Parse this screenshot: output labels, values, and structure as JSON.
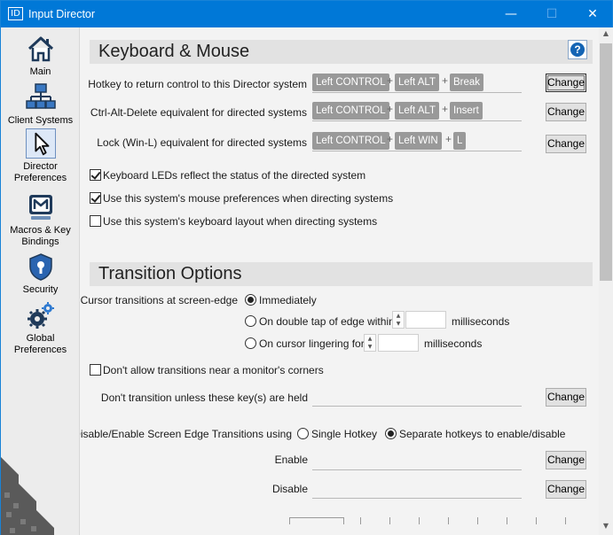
{
  "window": {
    "icon_text": "ID",
    "title": "Input Director",
    "minimize_glyph": "—",
    "maximize_glyph": "☐",
    "close_glyph": "✕"
  },
  "sidebar": {
    "items": [
      {
        "label": "Main",
        "icon": "home-icon"
      },
      {
        "label": "Client Systems",
        "icon": "network-icon"
      },
      {
        "label": "Director Preferences",
        "icon": "cursor-icon",
        "active": true
      },
      {
        "label": "Macros & Key Bindings",
        "icon": "macro-icon"
      },
      {
        "label": "Security",
        "icon": "shield-lock-icon"
      },
      {
        "label": "Global Preferences",
        "icon": "gears-icon"
      }
    ],
    "watermark_text": "AppNee Freeware Group."
  },
  "keyboard_mouse": {
    "title": "Keyboard & Mouse",
    "help_glyph": "?",
    "hotkeys": [
      {
        "label": "Hotkey to return control to this Director system",
        "keys": [
          "Left CONTROL",
          "Left ALT",
          "Break"
        ],
        "button": "Change"
      },
      {
        "label": "Ctrl-Alt-Delete equivalent for directed systems",
        "keys": [
          "Left CONTROL",
          "Left ALT",
          "Insert"
        ],
        "button": "Change"
      },
      {
        "label": "Lock (Win-L) equivalent for directed systems",
        "keys": [
          "Left CONTROL",
          "Left WIN",
          "L"
        ],
        "button": "Change"
      }
    ],
    "plus": "+",
    "checkboxes": [
      {
        "label": "Keyboard LEDs reflect the status of the directed system",
        "checked": true
      },
      {
        "label": "Use this system's mouse preferences when directing systems",
        "checked": true
      },
      {
        "label": "Use this system's keyboard layout when directing systems",
        "checked": false
      }
    ]
  },
  "transition": {
    "title": "Transition Options",
    "cursor_label": "Cursor transitions at screen-edge",
    "option_immediately": "Immediately",
    "option_double_tap": "On double tap of edge within",
    "option_linger": "On cursor lingering for",
    "unit_ms": "milliseconds",
    "spin_up": "▲",
    "spin_down": "▼",
    "double_tap_value": "",
    "linger_value": "",
    "corners_label": "Don't allow transitions near a monitor's corners",
    "corners_checked": false,
    "held_keys_label": "Don't transition unless these key(s) are held",
    "held_keys_button": "Change",
    "disable_enable_label": "Disable/Enable Screen Edge Transitions using",
    "option_single_hotkey": "Single Hotkey",
    "option_separate": "Separate hotkeys to enable/disable",
    "enable_label": "Enable",
    "enable_button": "Change",
    "disable_label": "Disable",
    "disable_button": "Change"
  },
  "scrollbar": {
    "up": "▲",
    "down": "▼"
  }
}
